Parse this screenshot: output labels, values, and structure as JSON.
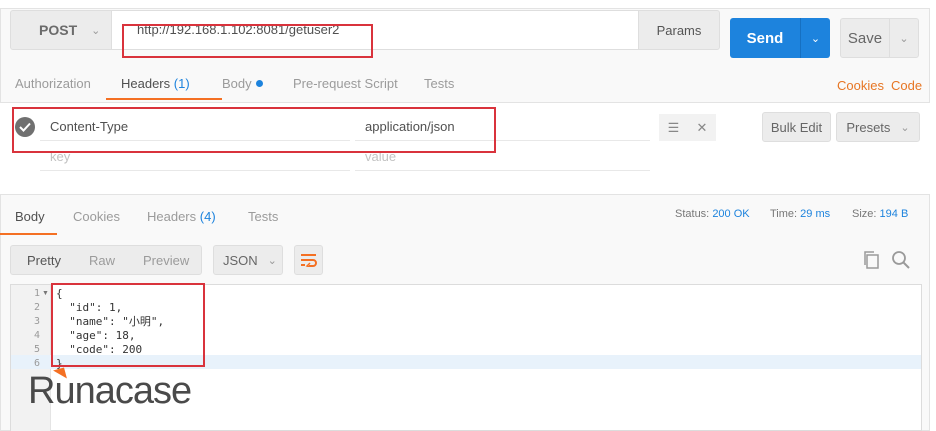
{
  "request": {
    "method": "POST",
    "url": "http://192.168.1.102:8081/getuser2",
    "params_label": "Params",
    "send_label": "Send",
    "save_label": "Save",
    "tabs": [
      {
        "label": "Authorization"
      },
      {
        "label": "Headers",
        "count": "(1)"
      },
      {
        "label": "Body"
      },
      {
        "label": "Pre-request Script"
      },
      {
        "label": "Tests"
      }
    ],
    "cookies_label": "Cookies",
    "code_label": "Code",
    "headers": [
      {
        "key": "Content-Type",
        "value": "application/json"
      }
    ],
    "key_placeholder": "key",
    "value_placeholder": "value",
    "bulk_edit_label": "Bulk Edit",
    "presets_label": "Presets"
  },
  "response": {
    "tabs": [
      {
        "label": "Body"
      },
      {
        "label": "Cookies"
      },
      {
        "label": "Headers",
        "count": "(4)"
      },
      {
        "label": "Tests"
      }
    ],
    "status_label": "Status:",
    "status_value": "200 OK",
    "time_label": "Time:",
    "time_value": "29 ms",
    "size_label": "Size:",
    "size_value": "194 B",
    "formats": [
      "Pretty",
      "Raw",
      "Preview"
    ],
    "active_format": "Pretty",
    "language": "JSON",
    "line_numbers": [
      "1",
      "2",
      "3",
      "4",
      "5",
      "6"
    ],
    "body_lines": [
      "{",
      "  \"id\": 1,",
      "  \"name\": \"小明\",",
      "  \"age\": 18,",
      "  \"code\": 200",
      "}"
    ]
  },
  "watermark": "Runacase",
  "colors": {
    "accent": "#1d83dd",
    "tab_underline": "#f47023",
    "highlight_box": "#d9333c"
  }
}
